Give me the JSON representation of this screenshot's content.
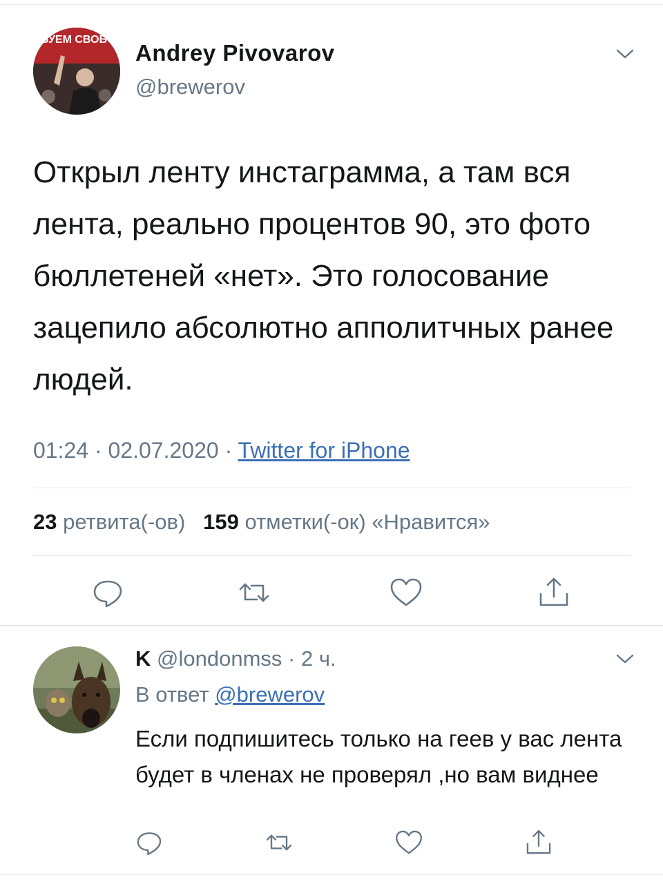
{
  "tweet": {
    "author_name": "Andrey Pivovarov",
    "author_handle": "@brewerov",
    "avatar_banner": "ТРЕБУЕМ СВОБОДЫ",
    "text": "Открыл ленту инстаграмма, а там вся лента, реально процентов 90, это фото бюллетеней «нет».  Это голосование зацепило абсолютно апполитчных ранее людей.",
    "time": "01:24",
    "date": "02.07.2020",
    "source": "Twitter for iPhone",
    "retweets_count": "23",
    "retweets_label": "ретвита(-ов)",
    "likes_count": "159",
    "likes_label": "отметки(-ок) «Нравится»"
  },
  "reply": {
    "author_name": "K",
    "author_handle": "@londonmss",
    "time_ago": "2 ч.",
    "reply_prefix": "В ответ",
    "reply_to_handle": "@brewerov",
    "text": "Если подпишитесь только на геев у вас лента будет в членах не проверял ,но вам виднее"
  },
  "icons": {
    "caret": "chevron-down-icon",
    "reply": "reply-icon",
    "retweet": "retweet-icon",
    "like": "heart-icon",
    "share": "share-icon"
  },
  "colors": {
    "text_primary": "#14171a",
    "text_secondary": "#657786",
    "link": "#3b6fb6",
    "divider": "#e1e8ed"
  }
}
